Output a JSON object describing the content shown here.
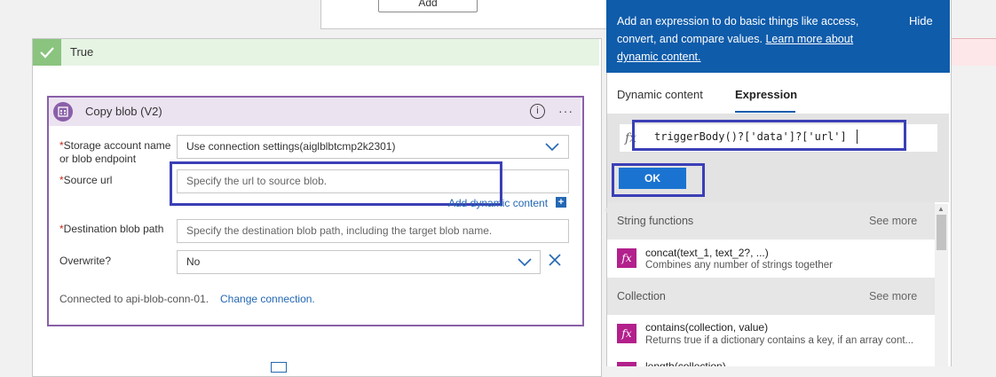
{
  "top_card": {
    "add_label": "Add"
  },
  "true_branch": {
    "label": "True"
  },
  "card": {
    "title": "Copy blob (V2)",
    "info_glyph": "i",
    "more_glyph": "···",
    "fields": {
      "storage_label": "Storage account name or blob endpoint",
      "storage_value": "Use connection settings(aiglblbtcmp2k2301)",
      "source_label": "Source url",
      "source_placeholder": "Specify the url to source blob.",
      "dest_label": "Destination blob path",
      "dest_placeholder": "Specify the destination blob path, including the target blob name.",
      "overwrite_label": "Overwrite?",
      "overwrite_value": "No"
    },
    "required_mark": "*",
    "add_dynamic": "Add dynamic content",
    "add_dynamic_plus": "+",
    "connected_text": "Connected to api-blob-conn-01.",
    "change_connection": "Change connection."
  },
  "panel": {
    "banner_text": "Add an expression to do basic things like access, convert, and compare values.",
    "banner_link": "Learn more about dynamic content.",
    "hide": "Hide",
    "tabs": [
      "Dynamic content",
      "Expression"
    ],
    "active_tab": "Expression",
    "fx_glyph": "fx",
    "expression": "triggerBody()?['data']?['url']",
    "ok_label": "OK",
    "sections": [
      {
        "title": "String functions",
        "see_more": "See more",
        "functions": [
          {
            "name": "concat(text_1, text_2?, ...)",
            "desc": "Combines any number of strings together"
          }
        ]
      },
      {
        "title": "Collection",
        "see_more": "See more",
        "functions": [
          {
            "name": "contains(collection, value)",
            "desc": "Returns true if a dictionary contains a key, if an array cont..."
          },
          {
            "name": "length(collection)",
            "desc": ""
          }
        ]
      }
    ]
  },
  "colors": {
    "banner": "#0f5cab",
    "card_border": "#8a5fa8",
    "highlight": "#3b3fb6",
    "fn_icon": "#b3208c",
    "true_check": "#8ac47f"
  },
  "icons": {
    "check": "check-icon",
    "blob": "blob-storage-icon",
    "info": "info-icon",
    "more": "more-options-icon",
    "chevron": "chevron-down-icon",
    "close": "close-icon",
    "fx": "function-icon"
  }
}
